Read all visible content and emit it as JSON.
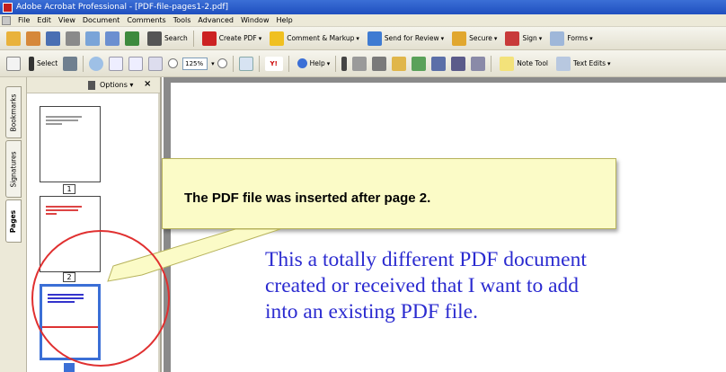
{
  "window": {
    "title": "Adobe Acrobat Professional - [PDF-file-pages1-2.pdf]"
  },
  "menu": [
    "File",
    "Edit",
    "View",
    "Document",
    "Comments",
    "Tools",
    "Advanced",
    "Window",
    "Help"
  ],
  "toolbar1": {
    "search": "Search",
    "create_pdf": "Create PDF",
    "comment_markup": "Comment & Markup",
    "send_for_review": "Send for Review",
    "secure": "Secure",
    "sign": "Sign",
    "forms": "Forms"
  },
  "toolbar2": {
    "select": "Select",
    "zoom": "125%",
    "help": "Help",
    "note_tool": "Note Tool",
    "text_edits": "Text Edits"
  },
  "nav_tabs": [
    "Bookmarks",
    "Signatures",
    "Pages"
  ],
  "pages_panel": {
    "options": "Options",
    "close": "×",
    "page_labels": [
      "1",
      "2"
    ]
  },
  "callout": {
    "text": "The PDF file was inserted after page 2."
  },
  "document": {
    "lines": [
      "This a totally different PDF document",
      "created or received that I want to add",
      "into an existing PDF file."
    ]
  },
  "colors": {
    "titlebar": "#1f4fbf",
    "doc_text": "#2b2bd0",
    "callout_bg": "#fbfbc7",
    "highlight_circle": "#e03030",
    "selected_thumb": "#3b6fd6"
  }
}
